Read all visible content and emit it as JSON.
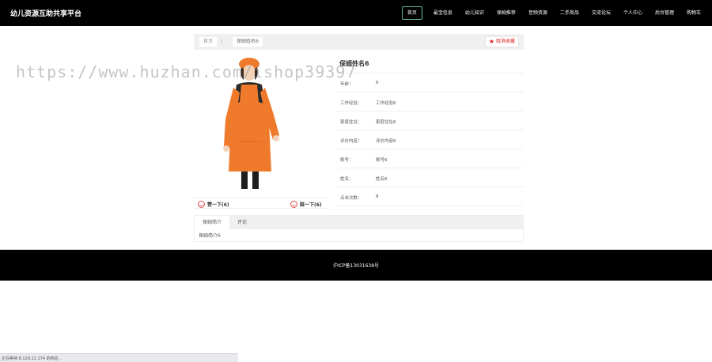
{
  "header": {
    "brand": "幼儿资源互助共享平台",
    "nav": [
      "首页",
      "最宝信息",
      "幼儿知识",
      "保姆推荐",
      "音频资源",
      "二手商品",
      "交流论坛",
      "个人中心",
      "后台管理",
      "购物车"
    ]
  },
  "breadcrumb": {
    "home": "首页",
    "separator": "/",
    "current": "保姆姓名6",
    "favorite_label": "取消收藏"
  },
  "votes": {
    "up_label": "赞一下(6)",
    "down_label": "踩一下(6)"
  },
  "detail": {
    "title": "保姆姓名6",
    "rows": [
      {
        "label": "年龄：",
        "value": "6"
      },
      {
        "label": "工作经验：",
        "value": "工作经验6"
      },
      {
        "label": "家庭住址：",
        "value": "家庭住址6"
      },
      {
        "label": "评价内容：",
        "value": "评价内容6"
      },
      {
        "label": "账号：",
        "value": "账号6"
      },
      {
        "label": "姓名：",
        "value": "姓名6"
      },
      {
        "label": "点击次数：",
        "value": "8"
      }
    ]
  },
  "tabs": {
    "items": [
      "保姆简介",
      "评论"
    ],
    "content": "保姆简介6"
  },
  "footer": {
    "text": "沪ICP备13031638号"
  },
  "status": {
    "text": "正在等待 8.129.11.174 的响应..."
  },
  "watermark": {
    "text": "https://www.huzhan.com/ishop39397"
  },
  "colors": {
    "header_bg": "#000000",
    "nav_active_border": "#5fb6a8",
    "favorite": "#e02020",
    "apron": "#f07a2c"
  }
}
